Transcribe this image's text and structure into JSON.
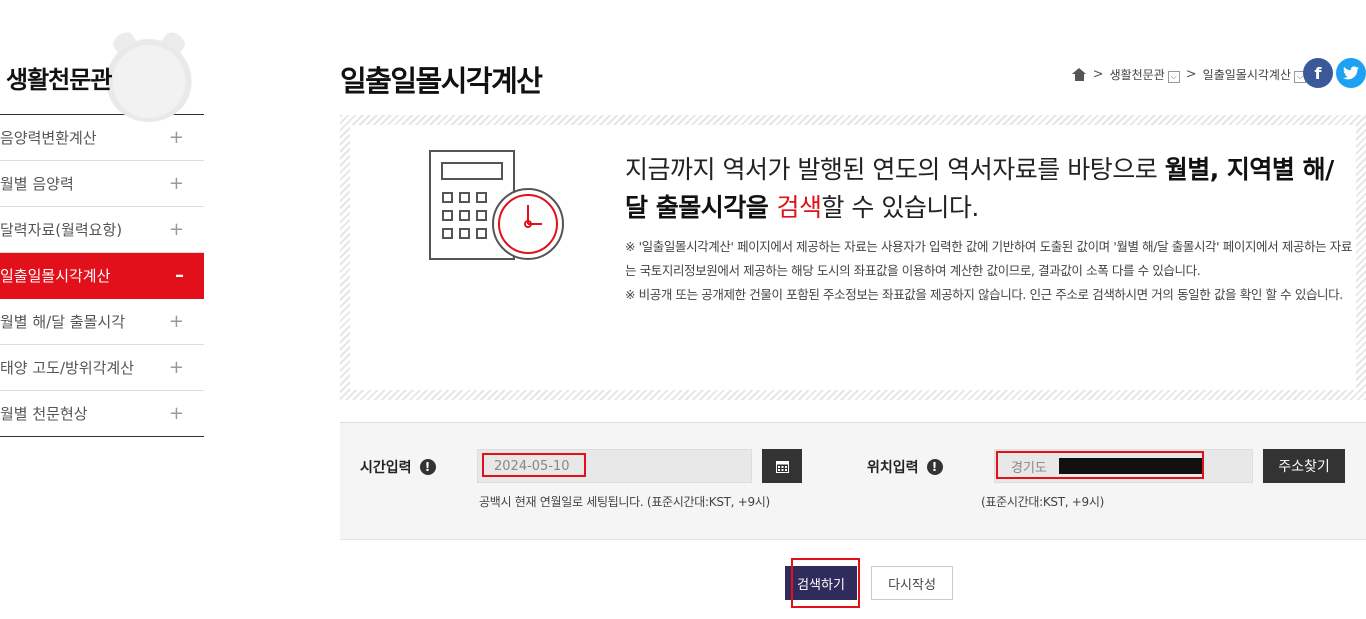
{
  "sidebar": {
    "title": "생활천문관",
    "items": [
      {
        "label": "음양력변환계산",
        "sign": "+"
      },
      {
        "label": "월별 음양력",
        "sign": "+"
      },
      {
        "label": "달력자료(월력요항)",
        "sign": "+"
      },
      {
        "label": "일출일몰시각계산",
        "sign": "–"
      },
      {
        "label": "월별 해/달 출몰시각",
        "sign": "+"
      },
      {
        "label": "태양 고도/방위각계산",
        "sign": "+"
      },
      {
        "label": "월별 천문현상",
        "sign": "+"
      }
    ],
    "active_index": 3
  },
  "header": {
    "title": "일출일몰시각계산",
    "breadcrumb": {
      "sep": ">",
      "level1": "생활천문관",
      "level2": "일출일몰시각계산",
      "dropdown_icon": "⌵"
    },
    "social": {
      "facebook": "f",
      "twitter": "t"
    }
  },
  "info": {
    "heading_part1": "지금까지 역서가 발행된 연도의 역서자료를 바탕으로 ",
    "heading_bold1": "월별, 지역별 해/달 출몰시각",
    "heading_part2": "을 ",
    "heading_red": "검색",
    "heading_part3": "할 수 있습니다.",
    "note1": "※ '일출일몰시각계산' 페이지에서 제공하는 자료는 사용자가 입력한 값에 기반하여 도출된 값이며 '월별 해/달 출몰시각' 페이지에서 제공하는 자료는 국토지리정보원에서 제공하는 해당 도시의 좌표값을 이용하여 계산한 값이므로, 결과값이 소폭 다를 수 있습니다.",
    "note2": "※ 비공개 또는 공개제한 건물이 포함된 주소정보는 좌표값을 제공하지 않습니다. 인근 주소로 검색하시면 거의 동일한 값을 확인 할 수 있습니다."
  },
  "form": {
    "time_label": "시간입력",
    "time_value": "2024-05-10",
    "time_hint": "공백시 현재 연월일로 세팅됩니다. (표준시간대:KST, +9시)",
    "location_label": "위치입력",
    "location_value": "경기도",
    "location_hint": "(표준시간대:KST, +9시)",
    "address_button": "주소찾기",
    "info_icon_glyph": "!"
  },
  "actions": {
    "search": "검색하기",
    "reset": "다시작성"
  },
  "colors": {
    "accent_red": "#e2101a",
    "dark_button": "#333333",
    "search_button": "#2f2c5c"
  }
}
